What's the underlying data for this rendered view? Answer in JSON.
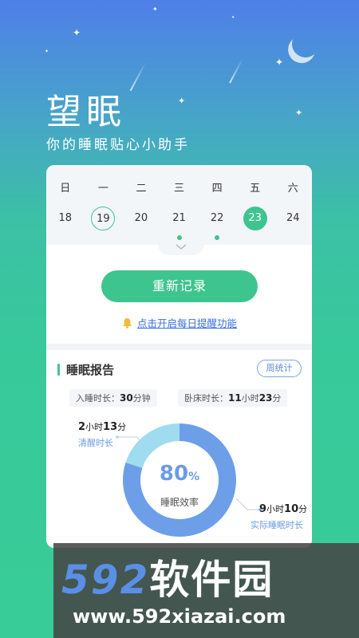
{
  "header": {
    "title": "望眠",
    "subtitle": "你的睡眠贴心小助手"
  },
  "calendar": {
    "weekdays": [
      "日",
      "一",
      "二",
      "三",
      "四",
      "五",
      "六"
    ],
    "dates": [
      "18",
      "19",
      "20",
      "21",
      "22",
      "23",
      "24"
    ],
    "today": "19",
    "selected": "23",
    "has_record": [
      "21",
      "22"
    ]
  },
  "actions": {
    "record_label": "重新记录",
    "reminder_label": "点击开启每日提醒功能"
  },
  "report": {
    "title": "睡眠报告",
    "weekly_label": "周统计",
    "sleep_onset_label": "入睡时长：",
    "sleep_onset_value": "30",
    "sleep_onset_unit": "分钟",
    "in_bed_label": "卧床时长：",
    "in_bed_hours": "11",
    "in_bed_hours_unit": "小时",
    "in_bed_minutes": "23",
    "in_bed_minutes_unit": "分",
    "efficiency_value": "80",
    "efficiency_unit": "%",
    "efficiency_label": "睡眠效率",
    "awake_hours": "2",
    "awake_hours_unit": "小时",
    "awake_minutes": "13",
    "awake_minutes_unit": "分",
    "awake_label": "清醒时长",
    "actual_hours": "9",
    "actual_hours_unit": "小时",
    "actual_minutes": "10",
    "actual_minutes_unit": "分",
    "actual_label": "实际睡眠时长"
  },
  "chart_data": {
    "type": "pie",
    "categories": [
      "清醒时长",
      "实际睡眠时长"
    ],
    "values": [
      20,
      80
    ],
    "colors": [
      "#9fdcef",
      "#6d9fe9"
    ]
  },
  "watermark": {
    "brand_digits": "592",
    "brand_text": "软件园",
    "url": "www.592xiazai.com"
  },
  "colors": {
    "accent_green": "#3ec58f",
    "accent_blue": "#6d9fe9"
  }
}
